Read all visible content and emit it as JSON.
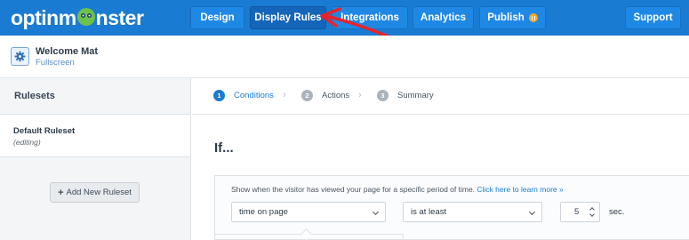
{
  "app": {
    "logo_text_left": "optinm",
    "logo_text_right": "nster"
  },
  "nav": {
    "design": "Design",
    "display_rules": "Display Rules",
    "integrations": "Integrations",
    "analytics": "Analytics",
    "publish": "Publish",
    "support": "Support"
  },
  "campaign": {
    "name": "Welcome Mat",
    "type": "Fullscreen"
  },
  "sidebar": {
    "heading": "Rulesets",
    "rulesets": [
      {
        "name": "Default Ruleset",
        "state": "(editing)"
      }
    ],
    "add_button": "Add New Ruleset"
  },
  "steps": [
    {
      "number": "1",
      "label": "Conditions",
      "state": "active"
    },
    {
      "number": "2",
      "label": "Actions",
      "state": "inactive"
    },
    {
      "number": "3",
      "label": "Summary",
      "state": "inactive"
    }
  ],
  "rule": {
    "heading": "If...",
    "description": "Show when the visitor has viewed your page for a specific period of time.",
    "learn_more": "Click here to learn more »",
    "condition": "time on page",
    "operator": "is at least",
    "value": "5",
    "unit": "sec."
  },
  "colors": {
    "brand_blue": "#1a7bd2",
    "active_step": "#1a7bd2",
    "inactive_step": "#aab3bc",
    "publish_indicator": "#f5a623",
    "annotation_arrow": "#e8232b"
  },
  "icons": {
    "campaign": "gear-icon",
    "publish_status": "pause-icon",
    "step_separator": "chevron-right-icon",
    "select": "chevron-down-icon",
    "stepper": "up-down-arrows-icon",
    "annotation": "arrow-annotation"
  }
}
